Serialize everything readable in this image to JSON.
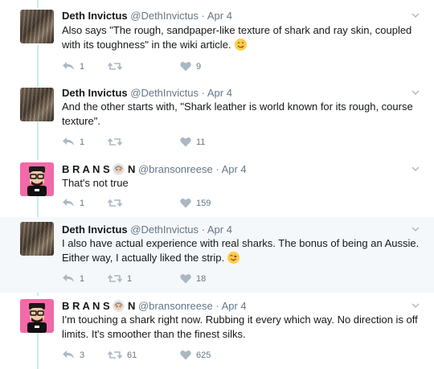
{
  "tweets": [
    {
      "name": "Deth Invictus",
      "handle": "@DethInvictus",
      "dot": "·",
      "date": "Apr 4",
      "text": "Also says \"The rough, sandpaper-like texture of shark and ray skin, coupled with its toughness\" in the wiki article.",
      "emoji": "yum",
      "replies": "1",
      "retweets": "",
      "likes": "9"
    },
    {
      "name": "Deth Invictus",
      "handle": "@DethInvictus",
      "dot": "·",
      "date": "Apr 4",
      "text": "And the other starts with, \"Shark leather is world known for its rough, course texture\".",
      "replies": "1",
      "retweets": "",
      "likes": "11"
    },
    {
      "name_part1": "B R A N S",
      "name_part2": "N",
      "handle": "@bransonreese",
      "dot": "·",
      "date": "Apr 4",
      "text": "That's not true",
      "replies": "1",
      "retweets": "",
      "likes": "159"
    },
    {
      "name": "Deth Invictus",
      "handle": "@DethInvictus",
      "dot": "·",
      "date": "Apr 4",
      "text": "I also have actual experience with real sharks.  The bonus of being an Aussie. Either way, I actually liked the strip.",
      "emoji": "wink-tongue",
      "replies": "1",
      "retweets": "1",
      "likes": "18"
    },
    {
      "name_part1": "B R A N S",
      "name_part2": "N",
      "handle": "@bransonreese",
      "dot": "·",
      "date": "Apr 4",
      "text": "I'm touching a shark right now. Rubbing it every which way. No direction is off limits. It's smoother than the finest silks.",
      "replies": "3",
      "retweets": "61",
      "likes": "625"
    }
  ],
  "colors": {
    "thread_line": "#c4f0e9",
    "highlight_bg": "#f5f8fa",
    "meta_gray": "#657786",
    "icon_gray": "#aab8c2",
    "branson_pink": "#f26aa8"
  },
  "icons": {
    "reply": "reply-icon",
    "retweet": "retweet-icon",
    "like": "heart-icon",
    "caret": "chevron-down-icon"
  }
}
